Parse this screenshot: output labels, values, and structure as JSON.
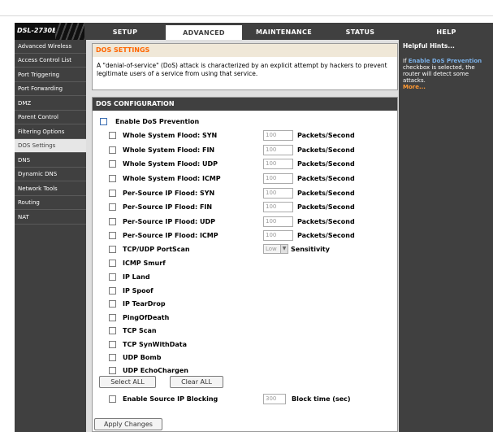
{
  "header": {
    "model": "DSL-2730E",
    "tabs": [
      {
        "label": "SETUP",
        "active": false
      },
      {
        "label": "ADVANCED",
        "active": true
      },
      {
        "label": "MAINTENANCE",
        "active": false
      },
      {
        "label": "STATUS",
        "active": false
      },
      {
        "label": "HELP",
        "active": false
      }
    ]
  },
  "sidebar": {
    "items": [
      {
        "label": "Advanced Wireless",
        "active": false
      },
      {
        "label": "Access Control List",
        "active": false
      },
      {
        "label": "Port Triggering",
        "active": false
      },
      {
        "label": "Port Forwarding",
        "active": false
      },
      {
        "label": "DMZ",
        "active": false
      },
      {
        "label": "Parent Control",
        "active": false
      },
      {
        "label": "Filtering Options",
        "active": false
      },
      {
        "label": "DOS Settings",
        "active": true
      },
      {
        "label": "DNS",
        "active": false
      },
      {
        "label": "Dynamic DNS",
        "active": false
      },
      {
        "label": "Network Tools",
        "active": false
      },
      {
        "label": "Routing",
        "active": false
      },
      {
        "label": "NAT",
        "active": false
      }
    ]
  },
  "dos_settings": {
    "title": "DOS SETTINGS",
    "description": "A \"denial-of-service\" (DoS) attack is characterized by an explicit attempt by hackers to prevent legitimate users of a service from using that service."
  },
  "dos_config": {
    "title": "DOS CONFIGURATION",
    "enable_label": "Enable DoS Prevention",
    "unit_label": "Packets/Second",
    "floods": [
      {
        "label": "Whole System Flood: SYN",
        "value": "100"
      },
      {
        "label": "Whole System Flood: FIN",
        "value": "100"
      },
      {
        "label": "Whole System Flood: UDP",
        "value": "100"
      },
      {
        "label": "Whole System Flood: ICMP",
        "value": "100"
      },
      {
        "label": "Per-Source IP Flood: SYN",
        "value": "100"
      },
      {
        "label": "Per-Source IP Flood: FIN",
        "value": "100"
      },
      {
        "label": "Per-Source IP Flood: UDP",
        "value": "100"
      },
      {
        "label": "Per-Source IP Flood: ICMP",
        "value": "100"
      }
    ],
    "portscan": {
      "label": "TCP/UDP PortScan",
      "selected": "Low",
      "sensitivity_label": "Sensitivity"
    },
    "attacks": [
      "ICMP Smurf",
      "IP Land",
      "IP Spoof",
      "IP TearDrop",
      "PingOfDeath",
      "TCP Scan",
      "TCP SynWithData",
      "UDP Bomb",
      "UDP EchoChargen"
    ],
    "select_all_label": "Select ALL",
    "clear_all_label": "Clear ALL",
    "blocking": {
      "label": "Enable Source IP Blocking",
      "value": "300",
      "unit": "Block time (sec)"
    },
    "apply_label": "Apply Changes"
  },
  "hints": {
    "title": "Helpful Hints...",
    "prefix": "If",
    "highlight": "Enable DoS Prevention",
    "text": "checkbox is selected, the router will detect some attacks.",
    "more": "More..."
  }
}
